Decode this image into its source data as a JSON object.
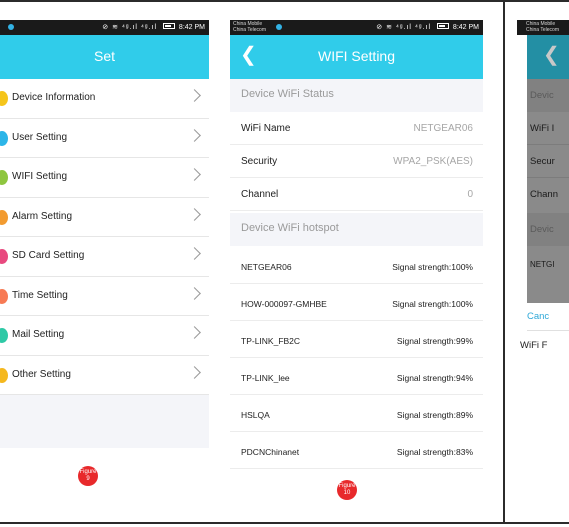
{
  "colors": {
    "accent": "#30ccea",
    "dot_colors": [
      "#f5c51b",
      "#2cb5e8",
      "#8ec63f",
      "#f29b30",
      "#e8497f",
      "#f77a54",
      "#2ec9a6",
      "#f5b81e"
    ],
    "badge": "#e8292b",
    "link": "#2ea8d8"
  },
  "icons": [
    "back-arrow-icon",
    "chevron-right-icon",
    "signal-icon",
    "wifi-icon",
    "battery-icon"
  ],
  "status_bar": {
    "carrier_line1": "China Mobile",
    "carrier_line2": "China Telecom",
    "icons": "⊘ ≋ ⁴ᵍ.ıl ⁴ᵍ.ıl",
    "time": "8:42 PM"
  },
  "set_screen": {
    "title": "Set",
    "items": [
      {
        "label": "Device Information"
      },
      {
        "label": "User Setting"
      },
      {
        "label": "WIFI Setting"
      },
      {
        "label": "Alarm Setting"
      },
      {
        "label": "SD Card Setting"
      },
      {
        "label": "Time Setting"
      },
      {
        "label": "Mail Setting"
      },
      {
        "label": "Other Setting"
      }
    ]
  },
  "wifi_screen": {
    "title": "WIFI Setting",
    "status_header": "Device WiFi Status",
    "status_rows": [
      {
        "label": "WiFi Name",
        "value": "NETGEAR06"
      },
      {
        "label": "Security",
        "value": "WPA2_PSK(AES)"
      },
      {
        "label": "Channel",
        "value": "0"
      }
    ],
    "hotspot_header": "Device WiFi hotspot",
    "hotspots": [
      {
        "name": "NETGEAR06",
        "signal": "Signal strength:100%"
      },
      {
        "name": "HOW-000097-GMHBE",
        "signal": "Signal strength:100%"
      },
      {
        "name": "TP-LINK_FB2C",
        "signal": "Signal strength:99%"
      },
      {
        "name": "TP-LINK_lee",
        "signal": "Signal strength:94%"
      },
      {
        "name": "HSLQA",
        "signal": "Signal strength:89%"
      },
      {
        "name": "PDCNChinanet",
        "signal": "Signal strength:83%"
      }
    ]
  },
  "partial_screen": {
    "rows": [
      "Devic",
      "WiFi I",
      "Secur",
      "Chann",
      "Devic",
      "NETGI"
    ],
    "cancel": "Canc",
    "wifi_password_label": "WiFi F"
  },
  "figures": {
    "fig9_word": "Figure",
    "fig9_num": "9",
    "fig10_word": "Figure",
    "fig10_num": "10"
  }
}
